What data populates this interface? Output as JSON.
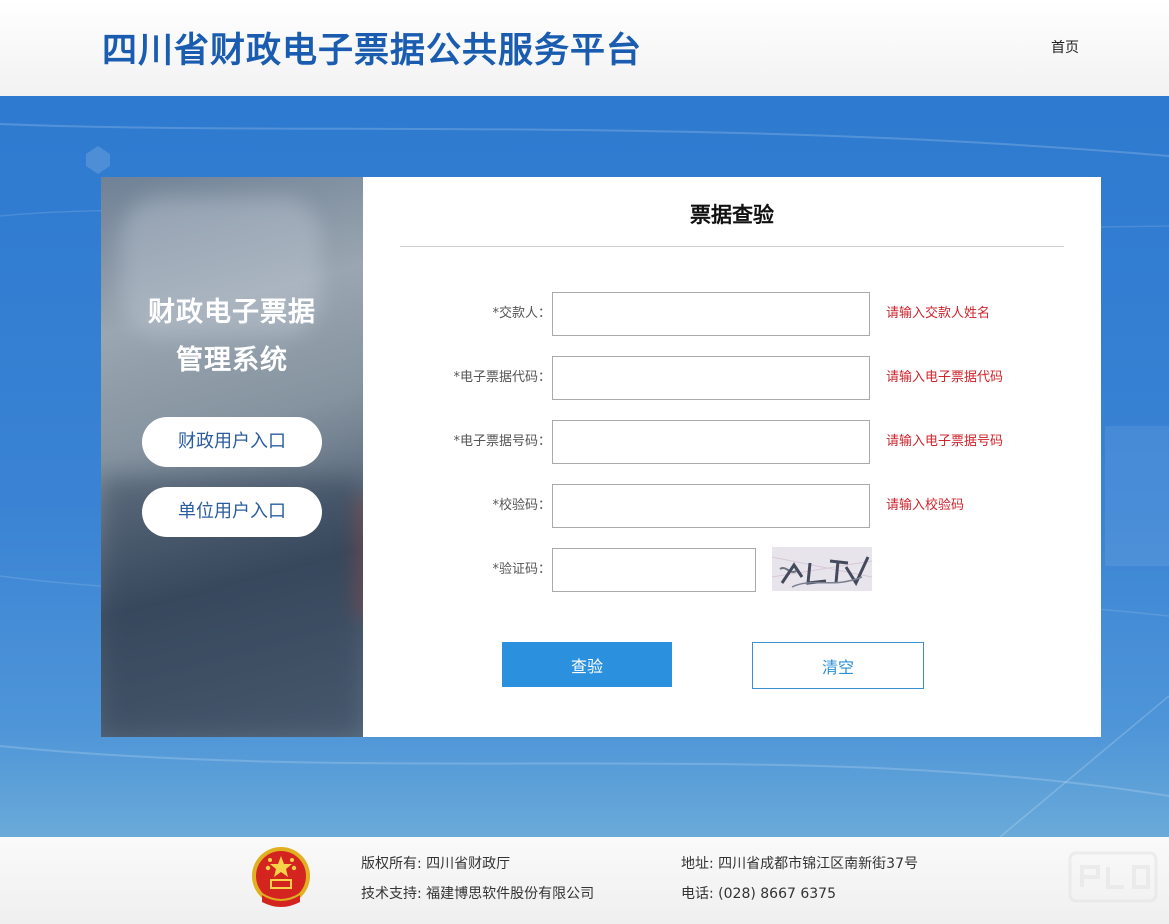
{
  "header": {
    "title": "四川省财政电子票据公共服务平台",
    "nav_home": "首页"
  },
  "left_panel": {
    "title_line1": "财政电子票据",
    "title_line2": "管理系统",
    "finance_entry": "财政用户入口",
    "unit_entry": "单位用户入口"
  },
  "form": {
    "title": "票据查验",
    "fields": [
      {
        "label": "*交款人：",
        "hint": "请输入交款人姓名",
        "value": ""
      },
      {
        "label": "*电子票据代码：",
        "hint": "请输入电子票据代码",
        "value": ""
      },
      {
        "label": "*电子票据号码：",
        "hint": "请输入电子票据号码",
        "value": ""
      },
      {
        "label": "*校验码：",
        "hint": "请输入校验码",
        "value": ""
      }
    ],
    "captcha_label": "*验证码：",
    "captcha_value": "",
    "captcha_text": "ALTV",
    "check_button": "查验",
    "clear_button": "清空"
  },
  "footer": {
    "copyright": "版权所有: 四川省财政厅",
    "support": "技术支持: 福建博思软件股份有限公司",
    "address": "地址: 四川省成都市锦江区南新街37号",
    "phone": "电话: (028) 8667 6375"
  },
  "colors": {
    "title_blue": "#1a5cb0",
    "band_blue": "#3a83d4",
    "button_blue": "#2b91de",
    "hint_red": "#d0242c"
  },
  "icons": [
    "national-emblem-icon",
    "captcha-image"
  ]
}
